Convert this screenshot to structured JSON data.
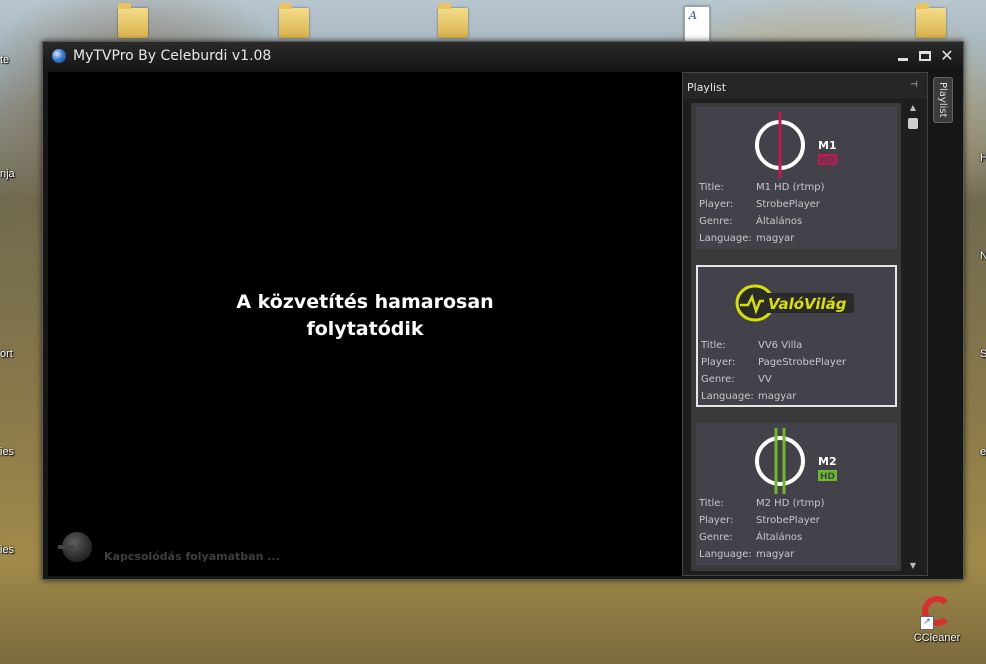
{
  "desktop": {
    "left_labels": [
      "te",
      "nja",
      "ort",
      "ies",
      "ies"
    ],
    "right_labels": [
      "H",
      "N",
      "S",
      "e"
    ],
    "ccleaner_label": "CCleaner"
  },
  "window": {
    "title": "MyTVPro By Celeburdi v1.08"
  },
  "video": {
    "message_line1": "A közvetítés hamarosan",
    "message_line2": "folytatódik",
    "status": "Kapcsolódás folyamatban ..."
  },
  "playlist": {
    "header": "Playlist",
    "side_tab": "Playlist",
    "meta_keys": {
      "title": "Title:",
      "player": "Player:",
      "genre": "Genre:",
      "language": "Language:"
    },
    "items": [
      {
        "logo_name": "M1",
        "logo_badge": "HD",
        "title": "M1 HD (rtmp)",
        "player": "StrobePlayer",
        "genre": "Általános",
        "language": "magyar",
        "accent": "#c0184f"
      },
      {
        "logo_name": "ValóVilág",
        "title": "VV6 Villa",
        "player": "PageStrobePlayer",
        "genre": "VV",
        "language": "magyar",
        "accent": "#d7e000"
      },
      {
        "logo_name": "M2",
        "logo_badge": "HD",
        "title": "M2 HD (rtmp)",
        "player": "StrobePlayer",
        "genre": "Általános",
        "language": "magyar",
        "accent": "#6dbb2b"
      }
    ]
  }
}
